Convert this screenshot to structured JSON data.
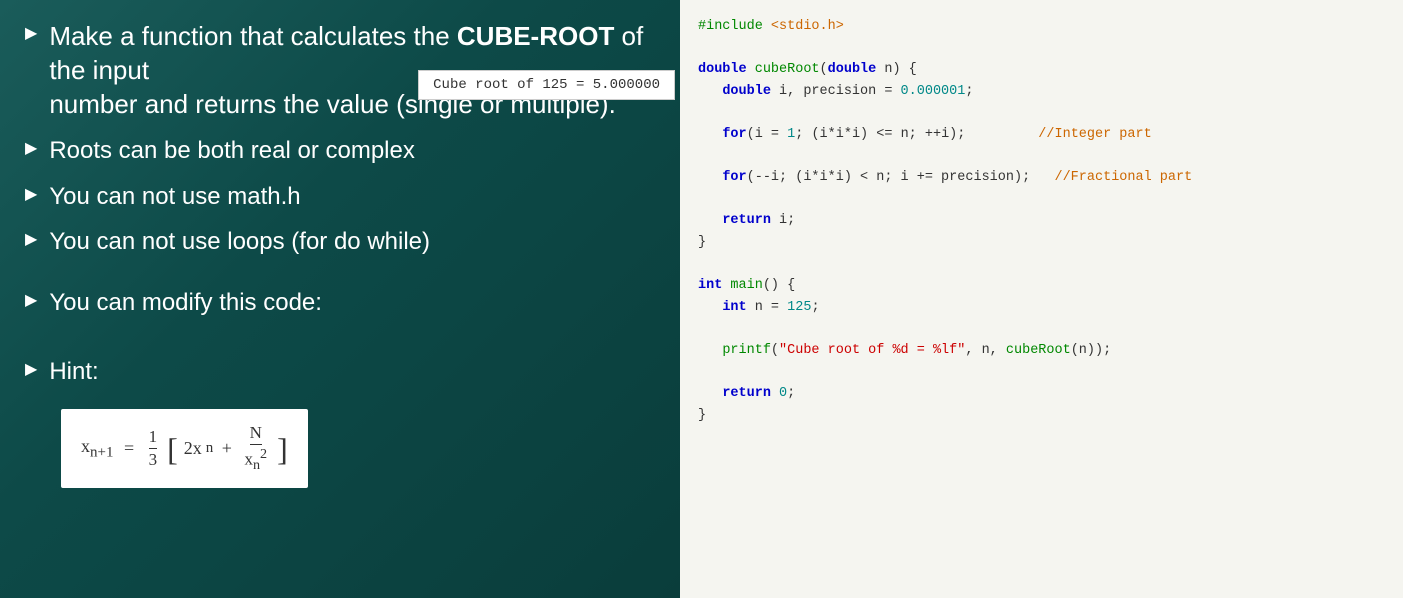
{
  "left": {
    "bullet1": "Make a function that calculates the CUBE-ROOT of the input number and returns the value (single or multiple).",
    "bullet2": "Roots can be both real or complex",
    "bullet3": "You can not use math.h",
    "bullet4": "You can not use loops (for do while)",
    "bullet5": "You can modify this code:",
    "hint_label": "Hint:",
    "output_label": "Cube root of 125 = 5.000000"
  },
  "code": {
    "include": "#include <stdio.h>",
    "lines": []
  }
}
